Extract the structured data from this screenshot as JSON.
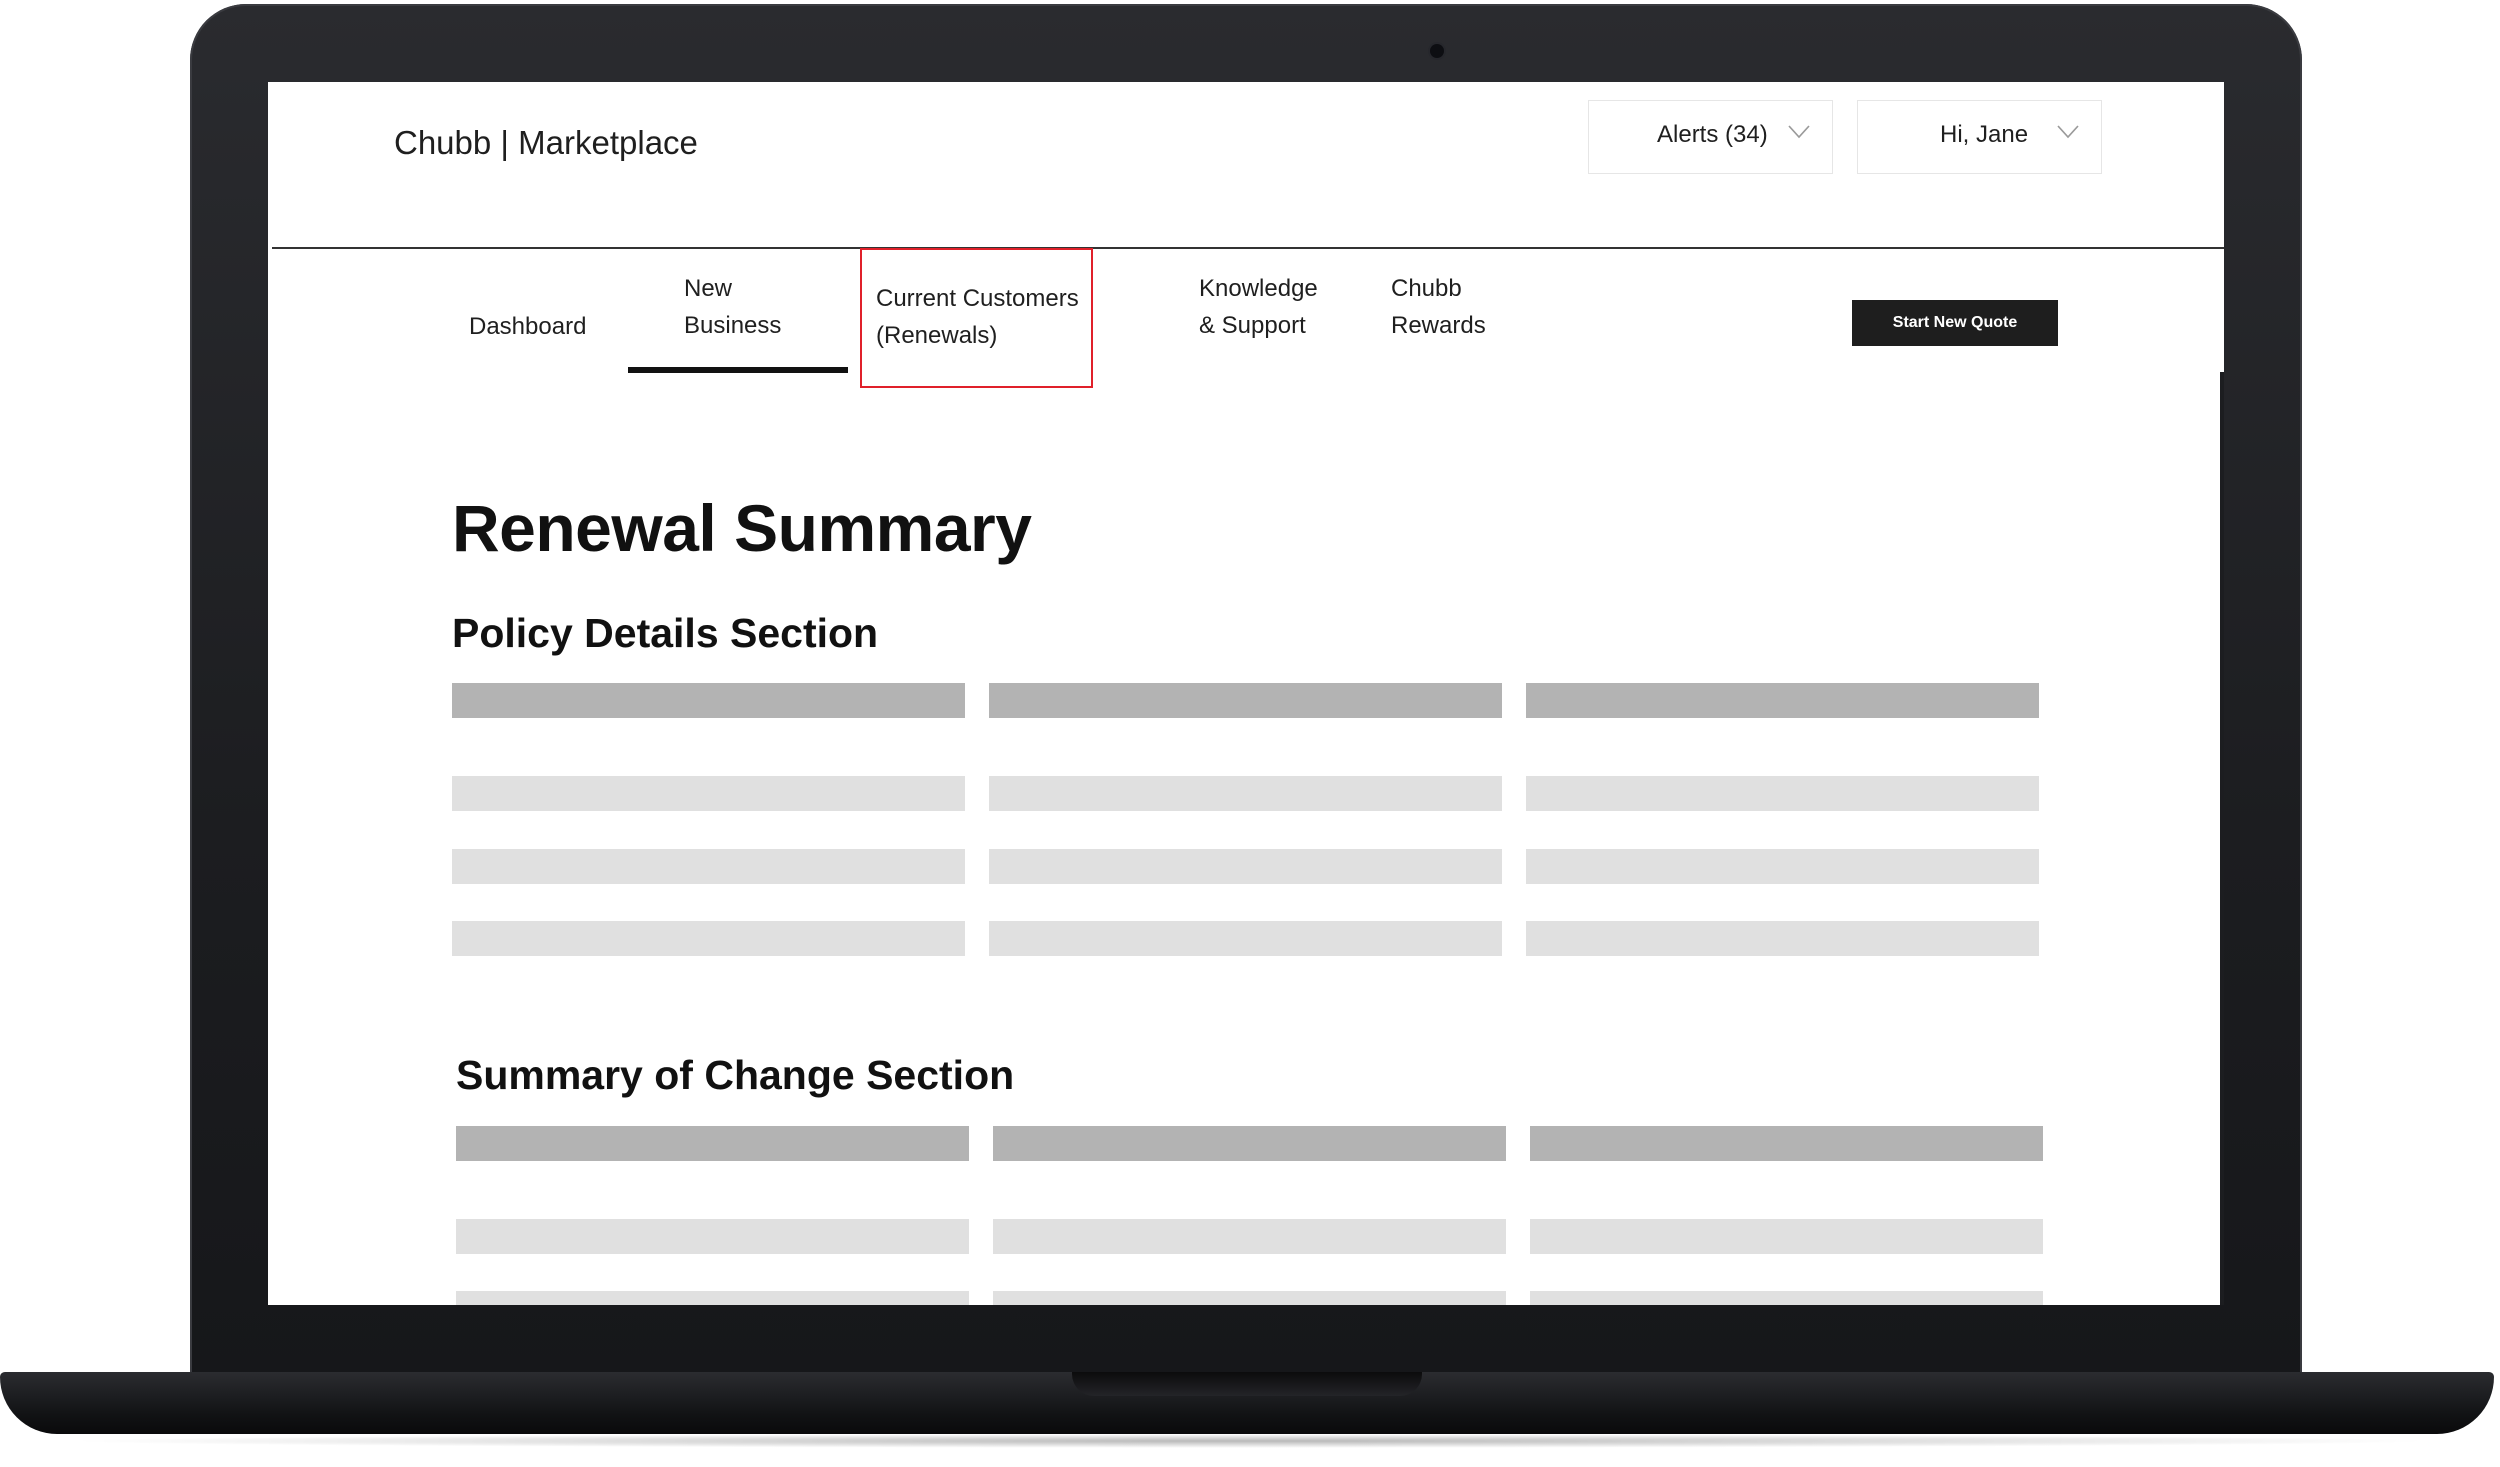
{
  "header": {
    "brand": "Chubb | Marketplace",
    "alerts_label": "Alerts (34)",
    "user_label": "Hi, Jane"
  },
  "nav": {
    "dashboard": "Dashboard",
    "new_business": [
      "New",
      "Business"
    ],
    "current_customers": [
      "Current Customers",
      "(Renewals)"
    ],
    "knowledge_support": [
      "Knowledge",
      "& Support"
    ],
    "chubb_rewards": [
      "Chubb",
      "Rewards"
    ],
    "active_tab": "New Business",
    "highlighted_tab": "Current Customers (Renewals)"
  },
  "cta_label": "Start New Quote",
  "page_title": "Renewal Summary",
  "sections": {
    "policy_title": "Policy Details Section",
    "change_title": "Summary of Change Section"
  },
  "colors": {
    "highlight_border": "#e0202a",
    "cta_background": "#1e1e1e",
    "placeholder_header": "#b3b3b3",
    "placeholder_row": "#e0e0e0"
  }
}
